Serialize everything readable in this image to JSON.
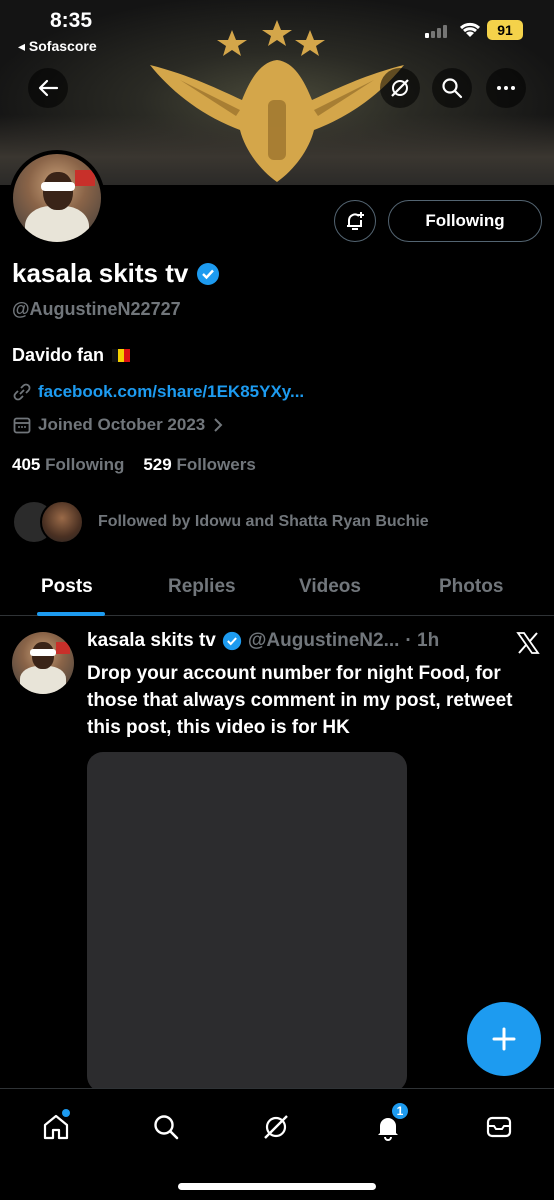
{
  "status_bar": {
    "time": "8:35",
    "back_app": "◂ Sofascore",
    "battery": "91"
  },
  "profile": {
    "follow_button": "Following",
    "name": "kasala skits tv",
    "handle": "@AugustineN22727",
    "bio": "Davido fan",
    "link": "facebook.com/share/1EK85YXy...",
    "joined": "Joined October 2023",
    "following_count": "405",
    "following_label": "Following",
    "followers_count": "529",
    "followers_label": "Followers",
    "followed_by": "Followed by Idowu and Shatta Ryan Buchie"
  },
  "tabs": [
    {
      "label": "Posts"
    },
    {
      "label": "Replies"
    },
    {
      "label": "Videos"
    },
    {
      "label": "Photos"
    }
  ],
  "post": {
    "name": "kasala skits tv",
    "handle": "@AugustineN2...",
    "time": "· 1h",
    "text": "Drop your account number for night Food, for those that always comment in my post, retweet this post, this video is for HK"
  },
  "bottom_nav": {
    "notifications_badge": "1"
  },
  "colors": {
    "accent": "#1d9bf0",
    "muted": "#71767b",
    "background": "#000000"
  },
  "icons": [
    "back-arrow-icon",
    "grok-icon",
    "search-icon",
    "more-icon",
    "notification-bell-icon",
    "link-icon",
    "calendar-icon",
    "chevron-right-icon",
    "verified-badge-icon",
    "x-logo-icon",
    "plus-icon",
    "home-icon",
    "mail-icon"
  ]
}
